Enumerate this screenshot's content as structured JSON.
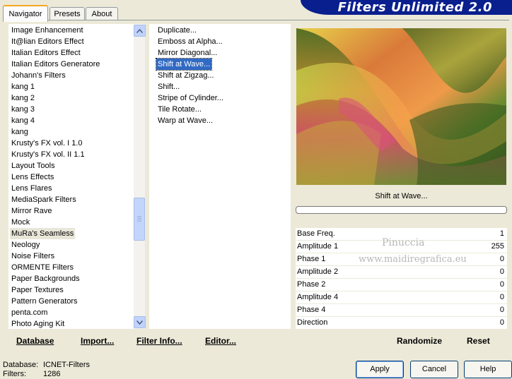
{
  "app": {
    "title": "Filters Unlimited 2.0"
  },
  "tabs": [
    {
      "label": "Navigator",
      "active": true
    },
    {
      "label": "Presets",
      "active": false
    },
    {
      "label": "About",
      "active": false
    }
  ],
  "categories": [
    {
      "label": "Image Enhancement",
      "selected": false
    },
    {
      "label": "It@lian Editors Effect",
      "selected": false
    },
    {
      "label": "Italian Editors Effect",
      "selected": false
    },
    {
      "label": "Italian Editors Generatore",
      "selected": false
    },
    {
      "label": "Johann's Filters",
      "selected": false
    },
    {
      "label": "kang 1",
      "selected": false
    },
    {
      "label": "kang 2",
      "selected": false
    },
    {
      "label": "kang 3",
      "selected": false
    },
    {
      "label": "kang 4",
      "selected": false
    },
    {
      "label": "kang",
      "selected": false
    },
    {
      "label": "Krusty's FX vol. I 1.0",
      "selected": false
    },
    {
      "label": "Krusty's FX vol. II 1.1",
      "selected": false
    },
    {
      "label": "Layout Tools",
      "selected": false
    },
    {
      "label": "Lens Effects",
      "selected": false
    },
    {
      "label": "Lens Flares",
      "selected": false
    },
    {
      "label": "MediaSpark Filters",
      "selected": false
    },
    {
      "label": "Mirror Rave",
      "selected": false
    },
    {
      "label": "Mock",
      "selected": false
    },
    {
      "label": "MuRa's Seamless",
      "selected": true
    },
    {
      "label": "Neology",
      "selected": false
    },
    {
      "label": "Noise Filters",
      "selected": false
    },
    {
      "label": "ORMENTE Filters",
      "selected": false
    },
    {
      "label": "Paper Backgrounds",
      "selected": false
    },
    {
      "label": "Paper Textures",
      "selected": false
    },
    {
      "label": "Pattern Generators",
      "selected": false
    },
    {
      "label": "penta.com",
      "selected": false
    },
    {
      "label": "Photo Aging Kit",
      "selected": false
    }
  ],
  "filters": [
    {
      "label": "Duplicate...",
      "selected": false
    },
    {
      "label": "Emboss at Alpha...",
      "selected": false
    },
    {
      "label": "Mirror Diagonal...",
      "selected": false
    },
    {
      "label": "Shift at Wave...",
      "selected": true
    },
    {
      "label": "Shift at Zigzag...",
      "selected": false
    },
    {
      "label": "Shift...",
      "selected": false
    },
    {
      "label": "Stripe of Cylinder...",
      "selected": false
    },
    {
      "label": "Tile Rotate...",
      "selected": false
    },
    {
      "label": "Warp at Wave...",
      "selected": false
    }
  ],
  "preview": {
    "filter_name": "Shift at Wave...",
    "progress_fraction": 0
  },
  "parameters": [
    {
      "label": "Base Freq.",
      "value": "1"
    },
    {
      "label": "Amplitude 1",
      "value": "255"
    },
    {
      "label": "Phase 1",
      "value": "0"
    },
    {
      "label": "Amplitude 2",
      "value": "0"
    },
    {
      "label": "Phase 2",
      "value": "0"
    },
    {
      "label": "Amplitude 4",
      "value": "0"
    },
    {
      "label": "Phase 4",
      "value": "0"
    },
    {
      "label": "Direction",
      "value": "0"
    }
  ],
  "watermark": {
    "line1": "Pinuccia",
    "line2": "www.maidiregrafica.eu"
  },
  "bottom_links": {
    "database": "Database",
    "import": "Import...",
    "filter_info": "Filter Info...",
    "editor": "Editor...",
    "randomize": "Randomize",
    "reset": "Reset"
  },
  "status": {
    "database_label": "Database:",
    "database_value": "ICNET-Filters",
    "filters_label": "Filters:",
    "filters_value": "1286"
  },
  "buttons": {
    "apply": "Apply",
    "cancel": "Cancel",
    "help": "Help"
  },
  "colors": {
    "banner": "#0a1f8e",
    "selection": "#316ac5",
    "dialog_bg": "#ece9d8"
  }
}
